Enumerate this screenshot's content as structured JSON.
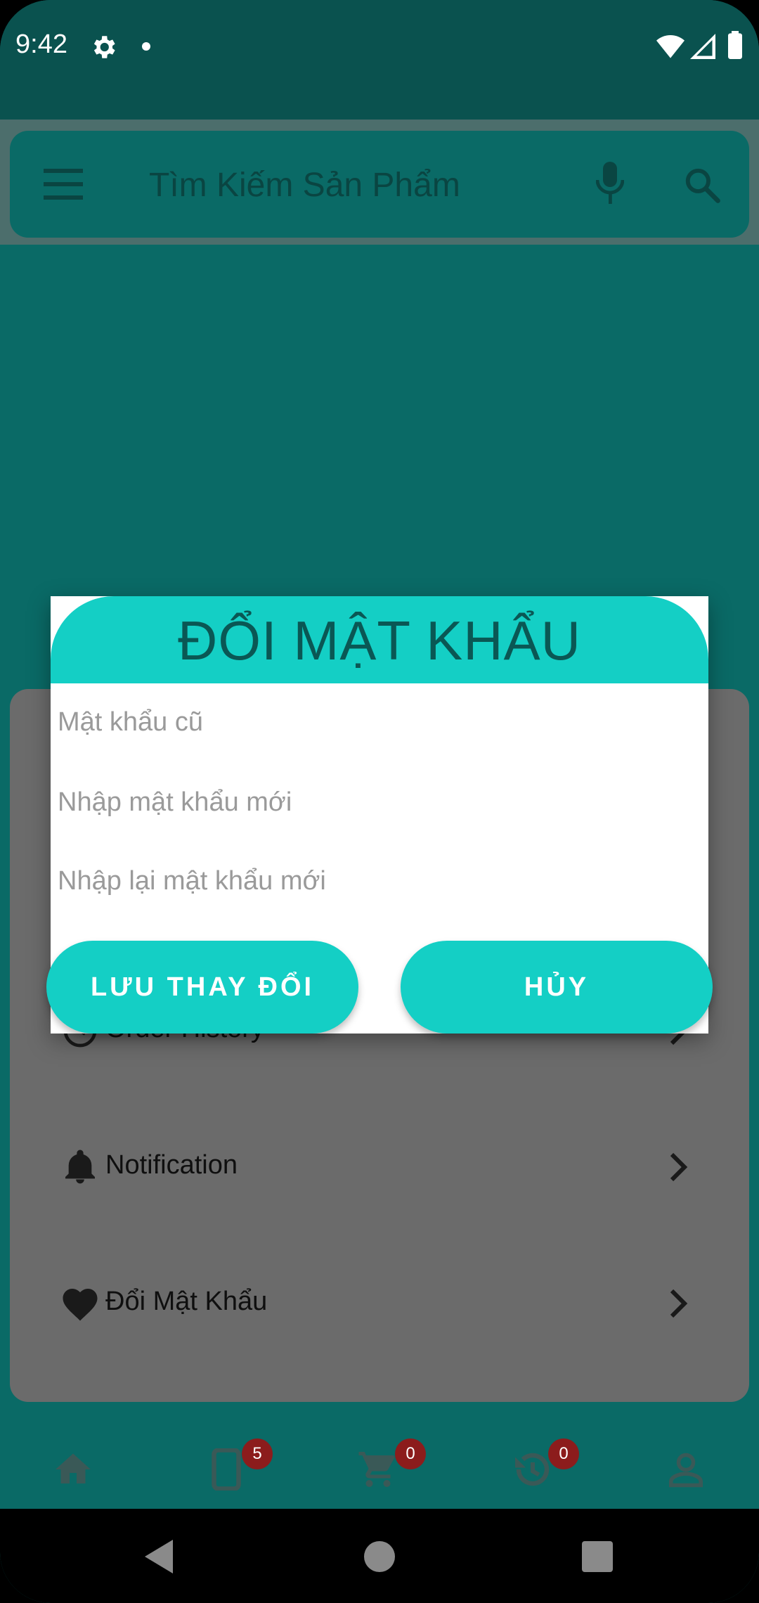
{
  "status_bar": {
    "time": "9:42"
  },
  "search": {
    "placeholder": "Tìm Kiếm Sản Phẩm"
  },
  "profile_menu": {
    "items": [
      {
        "label": "Order History",
        "icon": "history-icon"
      },
      {
        "label": "Notification",
        "icon": "bell-icon"
      },
      {
        "label": "Đổi Mật Khẩu",
        "icon": "heart-icon"
      }
    ]
  },
  "dialog": {
    "title": "ĐỔI MẬT KHẨU",
    "old_password_placeholder": "Mật khẩu cũ",
    "new_password_placeholder": "Nhập mật khẩu mới",
    "confirm_password_placeholder": "Nhập lại mật khẩu mới",
    "save_label": "LƯU THAY ĐỔI",
    "cancel_label": "HỦY"
  },
  "bottom_nav": {
    "items": [
      {
        "icon": "home-icon"
      },
      {
        "icon": "phone-icon",
        "badge": "5"
      },
      {
        "icon": "cart-icon",
        "badge": "0"
      },
      {
        "icon": "history-icon",
        "badge": "0"
      },
      {
        "icon": "profile-icon"
      }
    ]
  },
  "colors": {
    "primary": "#0a6a66",
    "status_bar": "#0a524f",
    "accent": "#14cfc5",
    "badge": "#8c1c1c",
    "scrim_card": "#6b6b6b"
  }
}
